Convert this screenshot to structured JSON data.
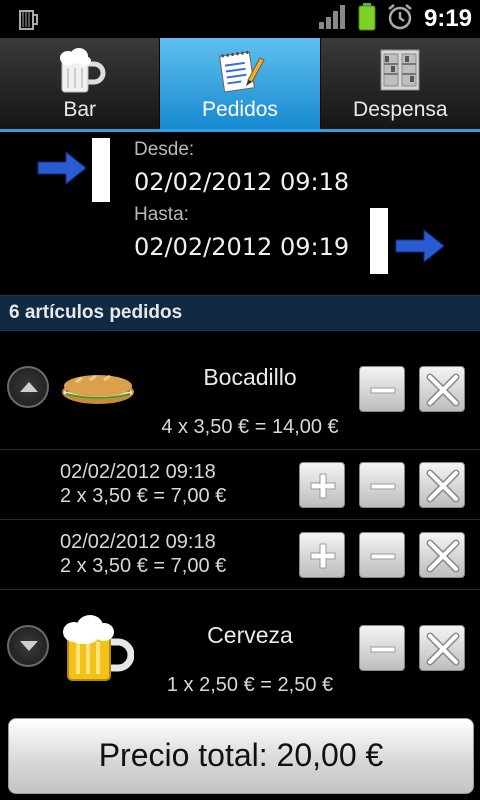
{
  "status_bar": {
    "time": "9:19",
    "left_icon": "beer-mug-icon",
    "icons": [
      "signal-icon",
      "battery-icon",
      "alarm-clock-icon"
    ]
  },
  "tabs": [
    {
      "label": "Bar",
      "icon": "beer-mug-icon",
      "active": false
    },
    {
      "label": "Pedidos",
      "icon": "notepad-icon",
      "active": true
    },
    {
      "label": "Despensa",
      "icon": "cabinet-icon",
      "active": false
    }
  ],
  "range": {
    "from_label": "Desde:",
    "from_date": "02/02/2012 09:18",
    "to_label": "Hasta:",
    "to_date": "02/02/2012 09:19"
  },
  "section": {
    "title": "6 artículos pedidos"
  },
  "items": [
    {
      "name": "Bocadillo",
      "calc": "4 x 3,50 € = 14,00 €",
      "image": "sandwich-icon",
      "expanded": true,
      "entries": [
        {
          "date": "02/02/2012 09:18",
          "calc": "2 x 3,50 € = 7,00 €"
        },
        {
          "date": "02/02/2012 09:18",
          "calc": "2 x 3,50 € = 7,00 €"
        }
      ]
    },
    {
      "name": "Cerveza",
      "calc": "1 x 2,50 € = 2,50 €",
      "image": "beer-mug-icon",
      "expanded": false
    }
  ],
  "total": {
    "label": "Precio total: 20,00 €"
  }
}
